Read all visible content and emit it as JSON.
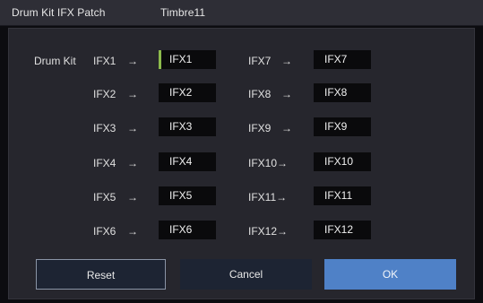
{
  "dialog": {
    "title": "Drum Kit IFX Patch",
    "timbre": "Timbre11"
  },
  "patch": {
    "source_label": "Drum Kit",
    "arrow": "→",
    "selected": "IFX1",
    "rows": [
      {
        "left_label": "IFX1",
        "left_value": "IFX1",
        "right_label": "IFX7",
        "right_value": "IFX7"
      },
      {
        "left_label": "IFX2",
        "left_value": "IFX2",
        "right_label": "IFX8",
        "right_value": "IFX8"
      },
      {
        "left_label": "IFX3",
        "left_value": "IFX3",
        "right_label": "IFX9",
        "right_value": "IFX9"
      },
      {
        "left_label": "IFX4",
        "left_value": "IFX4",
        "right_label": "IFX10→",
        "right_value": "IFX10"
      },
      {
        "left_label": "IFX5",
        "left_value": "IFX5",
        "right_label": "IFX11→",
        "right_value": "IFX11"
      },
      {
        "left_label": "IFX6",
        "left_value": "IFX6",
        "right_label": "IFX12→",
        "right_value": "IFX12"
      }
    ]
  },
  "buttons": {
    "reset": "Reset",
    "cancel": "Cancel",
    "ok": "OK"
  },
  "colors": {
    "selection_marker": "#8dbb4c",
    "ok_button": "#4f81c7",
    "panel": "#26262d"
  }
}
